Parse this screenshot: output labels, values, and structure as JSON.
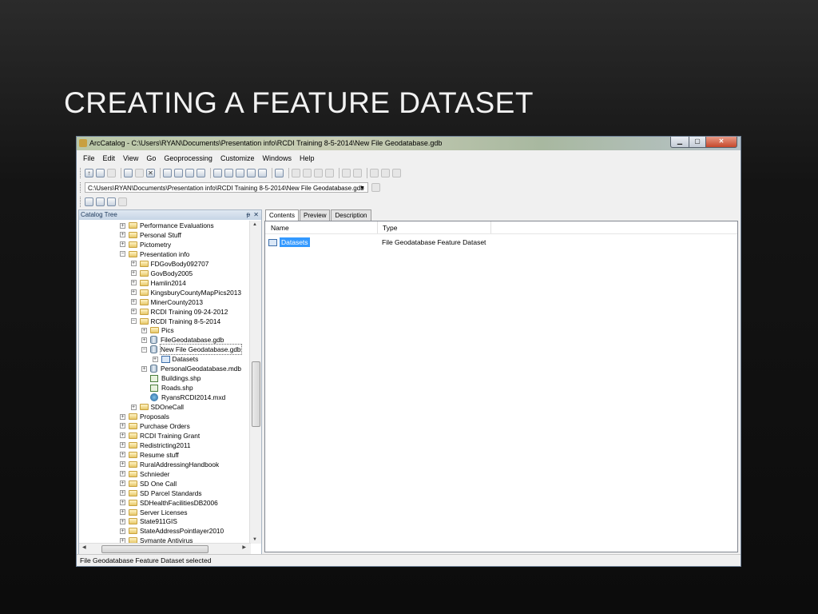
{
  "slide_title": "CREATING A FEATURE DATASET",
  "window": {
    "title": "ArcCatalog - C:\\Users\\RYAN\\Documents\\Presentation info\\RCDI Training 8-5-2014\\New File Geodatabase.gdb"
  },
  "menu": [
    "File",
    "Edit",
    "View",
    "Go",
    "Geoprocessing",
    "Customize",
    "Windows",
    "Help"
  ],
  "location": {
    "path": "C:\\Users\\RYAN\\Documents\\Presentation info\\RCDI Training 8-5-2014\\New File Geodatabase.gdb"
  },
  "catalog": {
    "title": "Catalog Tree",
    "pin": "ᵽ",
    "close": "✕",
    "items": [
      {
        "label": "Performance Evaluations",
        "depth": 0,
        "icon": "folder",
        "exp": "+"
      },
      {
        "label": "Personal Stuff",
        "depth": 0,
        "icon": "folder",
        "exp": "+"
      },
      {
        "label": "Pictometry",
        "depth": 0,
        "icon": "folder",
        "exp": "+"
      },
      {
        "label": "Presentation info",
        "depth": 0,
        "icon": "folder",
        "exp": "-"
      },
      {
        "label": "FDGovBody092707",
        "depth": 1,
        "icon": "folder",
        "exp": "+"
      },
      {
        "label": "GovBody2005",
        "depth": 1,
        "icon": "folder",
        "exp": "+"
      },
      {
        "label": "Hamlin2014",
        "depth": 1,
        "icon": "folder",
        "exp": "+"
      },
      {
        "label": "KingsburyCountyMapPics2013",
        "depth": 1,
        "icon": "folder",
        "exp": "+"
      },
      {
        "label": "MinerCounty2013",
        "depth": 1,
        "icon": "folder",
        "exp": "+"
      },
      {
        "label": "RCDI Training 09-24-2012",
        "depth": 1,
        "icon": "folder",
        "exp": "+"
      },
      {
        "label": "RCDI Training 8-5-2014",
        "depth": 1,
        "icon": "folder",
        "exp": "-"
      },
      {
        "label": "Pics",
        "depth": 2,
        "icon": "folder",
        "exp": "+"
      },
      {
        "label": "FileGeodatabase.gdb",
        "depth": 2,
        "icon": "gdb",
        "exp": "+"
      },
      {
        "label": "New File Geodatabase.gdb",
        "depth": 2,
        "icon": "gdb",
        "exp": "-"
      },
      {
        "label": "Datasets",
        "depth": 3,
        "icon": "dataset",
        "exp": "+"
      },
      {
        "label": "PersonalGeodatabase.mdb",
        "depth": 2,
        "icon": "gdb",
        "exp": "+"
      },
      {
        "label": "Buildings.shp",
        "depth": 2,
        "icon": "shp",
        "exp": ""
      },
      {
        "label": "Roads.shp",
        "depth": 2,
        "icon": "shp",
        "exp": ""
      },
      {
        "label": "RyansRCDI2014.mxd",
        "depth": 2,
        "icon": "mxd",
        "exp": ""
      },
      {
        "label": "SDOneCall",
        "depth": 1,
        "icon": "folder",
        "exp": "+"
      },
      {
        "label": "Proposals",
        "depth": 0,
        "icon": "folder",
        "exp": "+"
      },
      {
        "label": "Purchase Orders",
        "depth": 0,
        "icon": "folder",
        "exp": "+"
      },
      {
        "label": "RCDI Training Grant",
        "depth": 0,
        "icon": "folder",
        "exp": "+"
      },
      {
        "label": "Redistricting2011",
        "depth": 0,
        "icon": "folder",
        "exp": "+"
      },
      {
        "label": "Resume stuff",
        "depth": 0,
        "icon": "folder",
        "exp": "+"
      },
      {
        "label": "RuralAddressingHandbook",
        "depth": 0,
        "icon": "folder",
        "exp": "+"
      },
      {
        "label": "Schnieder",
        "depth": 0,
        "icon": "folder",
        "exp": "+"
      },
      {
        "label": "SD One Call",
        "depth": 0,
        "icon": "folder",
        "exp": "+"
      },
      {
        "label": "SD Parcel Standards",
        "depth": 0,
        "icon": "folder",
        "exp": "+"
      },
      {
        "label": "SDHealthFacilitiesDB2006",
        "depth": 0,
        "icon": "folder",
        "exp": "+"
      },
      {
        "label": "Server Licenses",
        "depth": 0,
        "icon": "folder",
        "exp": "+"
      },
      {
        "label": "State911GIS",
        "depth": 0,
        "icon": "folder",
        "exp": "+"
      },
      {
        "label": "StateAddressPointlayer2010",
        "depth": 0,
        "icon": "folder",
        "exp": "+"
      },
      {
        "label": "Symante Antivirus",
        "depth": 0,
        "icon": "folder",
        "exp": "+"
      }
    ]
  },
  "tabs": [
    "Contents",
    "Preview",
    "Description"
  ],
  "contents": {
    "columns": [
      "Name",
      "Type"
    ],
    "rows": [
      {
        "name": "Datasets",
        "type": "File Geodatabase Feature Dataset"
      }
    ]
  },
  "status": "File Geodatabase Feature Dataset selected",
  "colors": {
    "selection": "#3399ff",
    "accent": "#1e395b"
  }
}
